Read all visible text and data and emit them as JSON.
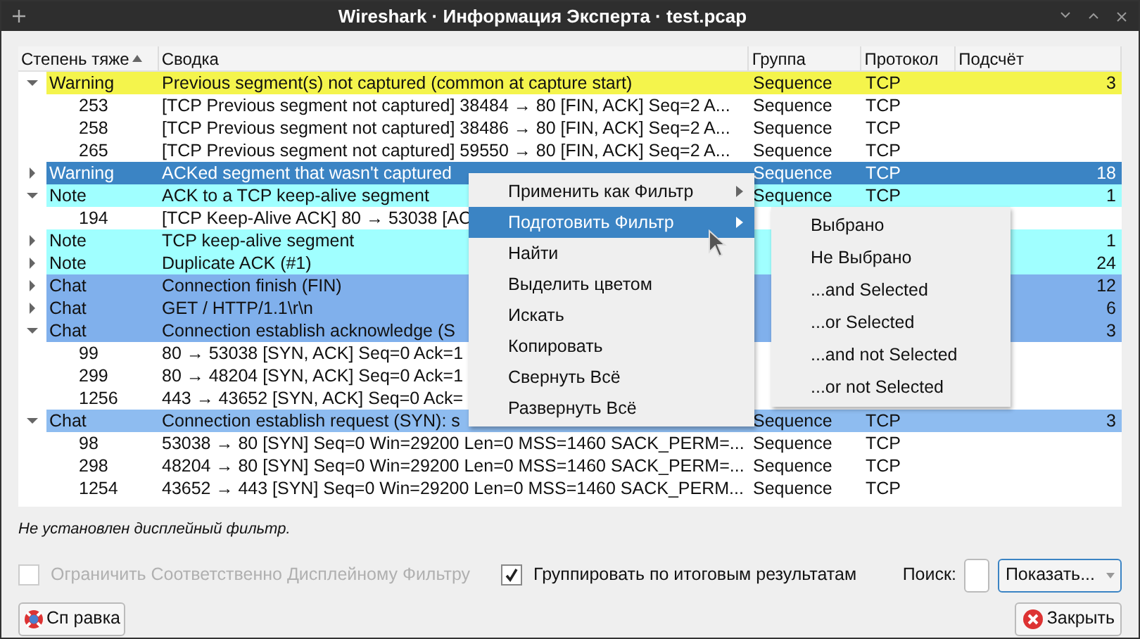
{
  "window": {
    "title": "Wireshark · Информация Эксперта · test.pcap"
  },
  "table": {
    "columns": [
      {
        "label": "Степень тяже",
        "sorted": true
      },
      {
        "label": "Сводка",
        "sorted": false
      },
      {
        "label": "Группа",
        "sorted": false
      },
      {
        "label": "Протокол",
        "sorted": false
      },
      {
        "label": "Подсчёт",
        "sorted": false
      }
    ],
    "rows": [
      {
        "severity": "Warning",
        "summary": "Previous segment(s) not captured (common at capture start)",
        "group": "Sequence",
        "protocol": "TCP",
        "count": "3",
        "color": "#f4f44c",
        "expanded": true,
        "selected": false,
        "children": [
          {
            "packet": "253",
            "summary": "[TCP Previous segment not captured] 38484 → 80 [FIN, ACK] Seq=2 A...",
            "group": "Sequence",
            "protocol": "TCP"
          },
          {
            "packet": "258",
            "summary": "[TCP Previous segment not captured] 38486 → 80 [FIN, ACK] Seq=2 A...",
            "group": "Sequence",
            "protocol": "TCP"
          },
          {
            "packet": "265",
            "summary": "[TCP Previous segment not captured] 59550 → 80 [FIN, ACK] Seq=2 A...",
            "group": "Sequence",
            "protocol": "TCP"
          }
        ]
      },
      {
        "severity": "Warning",
        "summary": "ACKed segment that wasn't captured",
        "group": "Sequence",
        "protocol": "TCP",
        "count": "18",
        "expanded": false,
        "selected": true
      },
      {
        "severity": "Note",
        "summary": "ACK to a TCP keep-alive segment",
        "group": "Sequence",
        "protocol": "TCP",
        "count": "1",
        "color": "#a0ffff",
        "expanded": true,
        "selected": false,
        "children": [
          {
            "packet": "194",
            "summary": "[TCP Keep-Alive ACK] 80 → 53038 [AC"
          }
        ]
      },
      {
        "severity": "Note",
        "summary": "TCP keep-alive segment",
        "count": "1",
        "color": "#a0ffff",
        "expanded": false,
        "selected": false
      },
      {
        "severity": "Note",
        "summary": "Duplicate ACK (#1)",
        "count": "24",
        "color": "#a0ffff",
        "expanded": false,
        "selected": false
      },
      {
        "severity": "Chat",
        "summary": "Connection finish (FIN)",
        "count": "12",
        "color": "#80b0ec",
        "expanded": false,
        "selected": false
      },
      {
        "severity": "Chat",
        "summary": "GET / HTTP/1.1\\r\\n",
        "count": "6",
        "color": "#80b0ec",
        "expanded": false,
        "selected": false
      },
      {
        "severity": "Chat",
        "summary": "Connection establish acknowledge (S",
        "count": "3",
        "color": "#80b0ec",
        "expanded": true,
        "selected": false,
        "children": [
          {
            "packet": "99",
            "summary": "80 → 53038 [SYN, ACK] Seq=0 Ack=1"
          },
          {
            "packet": "299",
            "summary": "80 → 48204 [SYN, ACK] Seq=0 Ack=1"
          },
          {
            "packet": "1256",
            "summary": "443 → 43652 [SYN, ACK] Seq=0 Ack="
          }
        ]
      },
      {
        "severity": "Chat",
        "summary": "Connection establish request (SYN): s",
        "group": "Sequence",
        "protocol": "TCP",
        "count": "3",
        "color": "#8ebcf0",
        "expanded": true,
        "selected": false,
        "children": [
          {
            "packet": "98",
            "summary": "53038 → 80 [SYN] Seq=0 Win=29200 Len=0 MSS=1460 SACK_PERM=...",
            "group": "Sequence",
            "protocol": "TCP"
          },
          {
            "packet": "298",
            "summary": "48204 → 80 [SYN] Seq=0 Win=29200 Len=0 MSS=1460 SACK_PERM=...",
            "group": "Sequence",
            "protocol": "TCP"
          },
          {
            "packet": "1254",
            "summary": "43652 → 443 [SYN] Seq=0 Win=29200 Len=0 MSS=1460 SACK_PERM...",
            "group": "Sequence",
            "protocol": "TCP"
          }
        ]
      }
    ]
  },
  "context_menu": {
    "items": [
      {
        "label": "Применить как Фильтр",
        "submenu": true,
        "selected": false
      },
      {
        "label": "Подготовить Фильтр",
        "submenu": true,
        "selected": true
      },
      {
        "label": "Найти",
        "submenu": false,
        "selected": false
      },
      {
        "label": "Выделить цветом",
        "submenu": false,
        "selected": false
      },
      {
        "label": "Искать",
        "submenu": false,
        "selected": false
      },
      {
        "label": "Копировать",
        "submenu": false,
        "selected": false
      },
      {
        "label": "Свернуть Всё",
        "submenu": false,
        "selected": false
      },
      {
        "label": "Развернуть Всё",
        "submenu": false,
        "selected": false
      }
    ],
    "submenu": [
      "Выбрано",
      "Не Выбрано",
      "...and Selected",
      "...or Selected",
      "...and not Selected",
      "...or not Selected"
    ]
  },
  "filter_status": "Не установлен дисплейный фильтр.",
  "limit_checkbox": {
    "label": "Ограничить Соответственно Дисплейному Фильтру",
    "checked": false,
    "disabled": true
  },
  "group_checkbox": {
    "label": "Группировать по итоговым результатам",
    "checked": true,
    "disabled": false
  },
  "search": {
    "label": "Поиск:"
  },
  "show_button": "Показать...",
  "help_button": "Сп равка",
  "close_button": "Закрыть"
}
